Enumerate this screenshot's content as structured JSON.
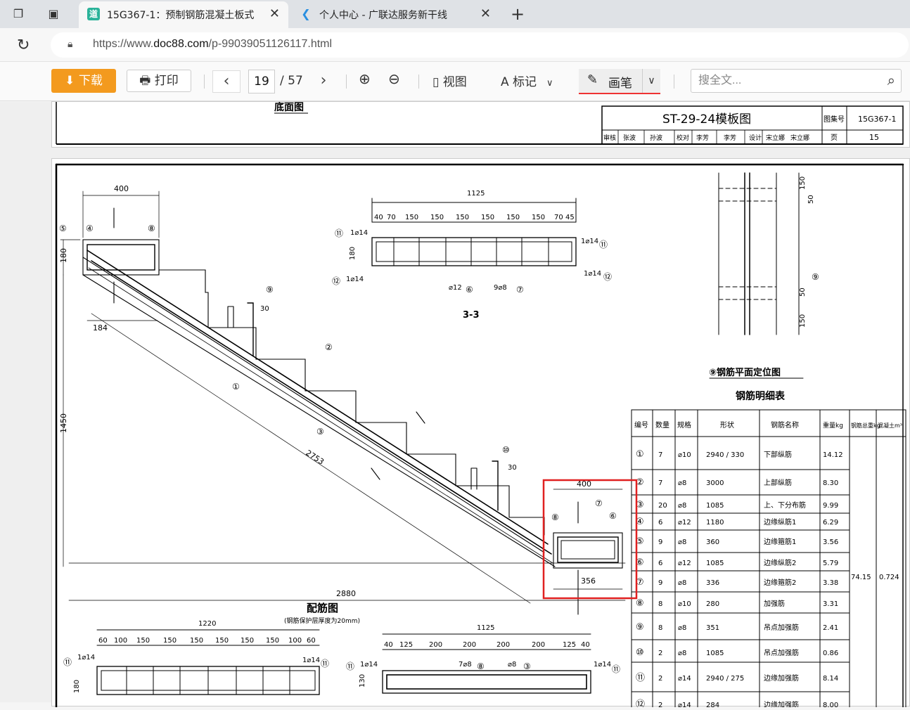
{
  "tabs": [
    {
      "title": "15G367-1：预制钢筋混凝土板式",
      "active": true,
      "favicon": "道"
    },
    {
      "title": "个人中心 - 广联达服务新干线",
      "active": false
    }
  ],
  "address": {
    "url_prefix": "https://www.",
    "url_host": "doc88.com",
    "url_path": "/p-99039051126117.html"
  },
  "toolbar": {
    "download": "下载",
    "print": "打印",
    "page_current": "19",
    "page_total": "/ 57",
    "view": "视图",
    "mark": "标记",
    "pen": "画笔",
    "search_placeholder": "搜全文..."
  },
  "drawing": {
    "top_page": {
      "label_bottom_view": "底面图",
      "title": "ST-29-24模板图",
      "atlas_label": "图集号",
      "atlas_no": "15G367-1",
      "page_label": "页",
      "page_no": "15",
      "sign_row": [
        "审核",
        "张波",
        "孙波",
        "校对",
        "李芳",
        "李芳",
        "设计",
        "宋立娜",
        "宋立娜"
      ]
    },
    "labels": {
      "reinf_view": "配筋图",
      "cover_note": "(钢筋保护层厚度为20mm)",
      "section_33": "3-3",
      "plan_9": "⑨钢筋平面定位图",
      "table_title": "钢筋明细表"
    },
    "dims": {
      "d400": "400",
      "d180": "180",
      "d184": "184",
      "d1450": "1450",
      "d2753": "2753",
      "d2880": "2880",
      "d356": "356",
      "d1125": "1125",
      "d1220": "1220",
      "d130": "130",
      "s33_row": [
        "40",
        "70",
        "150",
        "150",
        "150",
        "150",
        "150",
        "150",
        "70",
        "45"
      ],
      "bot_left_row": [
        "60",
        "100",
        "150",
        "150",
        "150",
        "150",
        "150",
        "150",
        "100",
        "60"
      ],
      "bot_mid_row": [
        "40",
        "125",
        "200",
        "200",
        "200",
        "200",
        "125",
        "40"
      ],
      "plan_dims": [
        "150",
        "50",
        "50",
        "150",
        "50"
      ]
    },
    "callouts": [
      "①",
      "②",
      "③",
      "④",
      "⑤",
      "⑥",
      "⑦",
      "⑧",
      "⑨",
      "⑩",
      "⑪",
      "⑫"
    ],
    "bar_notes": {
      "b14": "1⌀14",
      "b12": "⌀12",
      "b8": "9⌀8",
      "b8b": "7⌀8",
      "b8c": "⌀8",
      "d30": "30"
    },
    "table": {
      "headers": [
        "编号",
        "数量",
        "规格",
        "形状",
        "钢筋名称",
        "重量kg",
        "钢筋总重kg",
        "混凝土m³"
      ],
      "rows": [
        {
          "no": "①",
          "qty": "7",
          "spec": "⌀10",
          "shape": "2940 / 330",
          "name": "下部纵筋",
          "wt": "14.12"
        },
        {
          "no": "②",
          "qty": "7",
          "spec": "⌀8",
          "shape": "3000",
          "name": "上部纵筋",
          "wt": "8.30"
        },
        {
          "no": "③",
          "qty": "20",
          "spec": "⌀8",
          "shape": "1085",
          "name": "上、下分布筋",
          "wt": "9.99"
        },
        {
          "no": "④",
          "qty": "6",
          "spec": "⌀12",
          "shape": "1180",
          "name": "边缘纵筋1",
          "wt": "6.29"
        },
        {
          "no": "⑤",
          "qty": "9",
          "spec": "⌀8",
          "shape": "360",
          "name": "边缘箍筋1",
          "wt": "3.56"
        },
        {
          "no": "⑥",
          "qty": "6",
          "spec": "⌀12",
          "shape": "1085",
          "name": "边缘纵筋2",
          "wt": "5.79"
        },
        {
          "no": "⑦",
          "qty": "9",
          "spec": "⌀8",
          "shape": "336",
          "name": "边缘箍筋2",
          "wt": "3.38"
        },
        {
          "no": "⑧",
          "qty": "8",
          "spec": "⌀10",
          "shape": "280",
          "name": "加强筋",
          "wt": "3.31"
        },
        {
          "no": "⑨",
          "qty": "8",
          "spec": "⌀8",
          "shape": "351",
          "name": "吊点加强筋",
          "wt": "2.41"
        },
        {
          "no": "⑩",
          "qty": "2",
          "spec": "⌀8",
          "shape": "1085",
          "name": "吊点加强筋",
          "wt": "0.86"
        },
        {
          "no": "⑪",
          "qty": "2",
          "spec": "⌀14",
          "shape": "2940 / 275",
          "name": "边缘加强筋",
          "wt": "8.14"
        },
        {
          "no": "⑫",
          "qty": "2",
          "spec": "⌀14",
          "shape": "284",
          "name": "边缘加强筋",
          "wt": "8.00"
        }
      ],
      "total_wt": "74.15",
      "concrete": "0.724"
    }
  },
  "colors": {
    "download_btn": "#f39a1e",
    "highlight_box": "#e02020",
    "pen_underline": "#e33333"
  }
}
